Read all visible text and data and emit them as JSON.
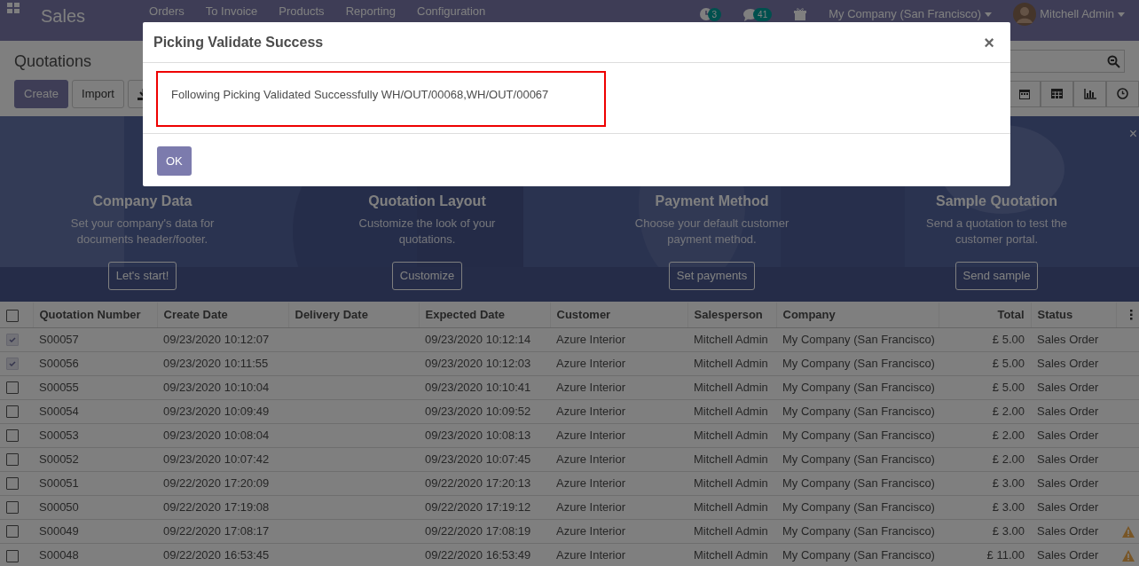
{
  "navbar": {
    "app_name": "Sales",
    "menu": [
      "Orders",
      "To Invoice",
      "Products",
      "Reporting",
      "Configuration"
    ],
    "activity_count": "3",
    "message_count": "41",
    "company": "My Company (San Francisco)",
    "user": "Mitchell Admin"
  },
  "control_panel": {
    "title": "Quotations",
    "buttons": [
      "Create",
      "Import"
    ]
  },
  "banner": {
    "close": "×",
    "steps": [
      {
        "title": "Company Data",
        "text": "Set your company's data for documents header/footer.",
        "button": "Let's start!"
      },
      {
        "title": "Quotation Layout",
        "text": "Customize the look of your quotations.",
        "button": "Customize"
      },
      {
        "title": "Payment Method",
        "text": "Choose your default customer payment method.",
        "button": "Set payments"
      },
      {
        "title": "Sample Quotation",
        "text": "Send a quotation to test the customer portal.",
        "button": "Send sample"
      }
    ]
  },
  "table": {
    "all_selected": false,
    "columns": [
      "Quotation Number",
      "Create Date",
      "Delivery Date",
      "Expected Date",
      "Customer",
      "Salesperson",
      "Company",
      "Total",
      "Status"
    ],
    "rows": [
      {
        "selected": true,
        "warning": false,
        "cells": [
          "S00057",
          "09/23/2020 10:12:07",
          "",
          "09/23/2020 10:12:14",
          "Azure Interior",
          "Mitchell Admin",
          "My Company (San Francisco)",
          "£ 5.00",
          "Sales Order"
        ]
      },
      {
        "selected": true,
        "warning": false,
        "cells": [
          "S00056",
          "09/23/2020 10:11:55",
          "",
          "09/23/2020 10:12:03",
          "Azure Interior",
          "Mitchell Admin",
          "My Company (San Francisco)",
          "£ 5.00",
          "Sales Order"
        ]
      },
      {
        "selected": false,
        "warning": false,
        "cells": [
          "S00055",
          "09/23/2020 10:10:04",
          "",
          "09/23/2020 10:10:41",
          "Azure Interior",
          "Mitchell Admin",
          "My Company (San Francisco)",
          "£ 5.00",
          "Sales Order"
        ]
      },
      {
        "selected": false,
        "warning": false,
        "cells": [
          "S00054",
          "09/23/2020 10:09:49",
          "",
          "09/23/2020 10:09:52",
          "Azure Interior",
          "Mitchell Admin",
          "My Company (San Francisco)",
          "£ 2.00",
          "Sales Order"
        ]
      },
      {
        "selected": false,
        "warning": false,
        "cells": [
          "S00053",
          "09/23/2020 10:08:04",
          "",
          "09/23/2020 10:08:13",
          "Azure Interior",
          "Mitchell Admin",
          "My Company (San Francisco)",
          "£ 2.00",
          "Sales Order"
        ]
      },
      {
        "selected": false,
        "warning": false,
        "cells": [
          "S00052",
          "09/23/2020 10:07:42",
          "",
          "09/23/2020 10:07:45",
          "Azure Interior",
          "Mitchell Admin",
          "My Company (San Francisco)",
          "£ 2.00",
          "Sales Order"
        ]
      },
      {
        "selected": false,
        "warning": false,
        "cells": [
          "S00051",
          "09/22/2020 17:20:09",
          "",
          "09/22/2020 17:20:13",
          "Azure Interior",
          "Mitchell Admin",
          "My Company (San Francisco)",
          "£ 3.00",
          "Sales Order"
        ]
      },
      {
        "selected": false,
        "warning": false,
        "cells": [
          "S00050",
          "09/22/2020 17:19:08",
          "",
          "09/22/2020 17:19:12",
          "Azure Interior",
          "Mitchell Admin",
          "My Company (San Francisco)",
          "£ 3.00",
          "Sales Order"
        ]
      },
      {
        "selected": false,
        "warning": true,
        "cells": [
          "S00049",
          "09/22/2020 17:08:17",
          "",
          "09/22/2020 17:08:19",
          "Azure Interior",
          "Mitchell Admin",
          "My Company (San Francisco)",
          "£ 3.00",
          "Sales Order"
        ]
      },
      {
        "selected": false,
        "warning": true,
        "cells": [
          "S00048",
          "09/22/2020 16:53:45",
          "",
          "09/22/2020 16:53:49",
          "Azure Interior",
          "Mitchell Admin",
          "My Company (San Francisco)",
          "£ 11.00",
          "Sales Order"
        ]
      }
    ]
  },
  "modal": {
    "title": "Picking Validate Success",
    "close": "×",
    "message": "Following Picking Validated Successfully WH/OUT/00068,WH/OUT/00067",
    "button": "OK"
  }
}
